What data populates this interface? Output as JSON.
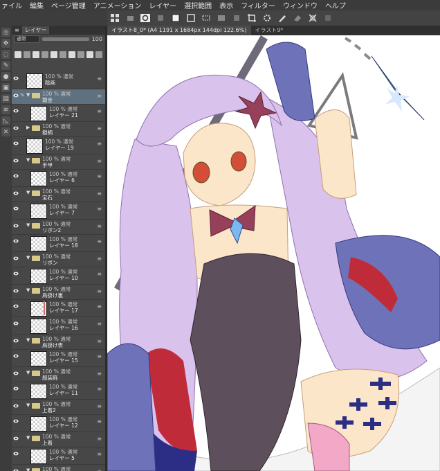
{
  "menu": [
    "ァイル",
    "編集",
    "ページ管理",
    "アニメーション",
    "レイヤー",
    "選択範囲",
    "表示",
    "フィルター",
    "ウィンドウ",
    "ヘルプ"
  ],
  "tabs": [
    {
      "label": "イラスト8_0* (A4 1191 x 1684px 144dpi 122.6%)",
      "active": true
    },
    {
      "label": "イラスト9*",
      "active": false
    }
  ],
  "panel": {
    "tab_label": "レイヤー",
    "blend_mode": "通常",
    "opacity": "100"
  },
  "layers": [
    {
      "mode": "100 % 通常",
      "name": "陰画",
      "kind": "layer",
      "level": 0
    },
    {
      "mode": "100 % 通常",
      "name": "鎖金",
      "kind": "folder",
      "level": 0,
      "selected": true
    },
    {
      "mode": "100 % 通常",
      "name": "レイヤー 21",
      "kind": "layer",
      "level": 1
    },
    {
      "mode": "100 % 通常",
      "name": "鎖柄",
      "kind": "folder",
      "level": 0,
      "collapsed": true
    },
    {
      "mode": "100 % 通常",
      "name": "レイヤー 19",
      "kind": "layer",
      "level": 0
    },
    {
      "mode": "100 % 通常",
      "name": "手甲",
      "kind": "folder",
      "level": 0
    },
    {
      "mode": "100 % 通常",
      "name": "レイヤー 6",
      "kind": "layer",
      "level": 1
    },
    {
      "mode": "100 % 通常",
      "name": "宝石",
      "kind": "folder",
      "level": 0
    },
    {
      "mode": "100 % 通常",
      "name": "レイヤー 7",
      "kind": "layer",
      "level": 1
    },
    {
      "mode": "100 % 通常",
      "name": "リボン2",
      "kind": "folder",
      "level": 0
    },
    {
      "mode": "100 % 通常",
      "name": "レイヤー 18",
      "kind": "layer",
      "level": 1
    },
    {
      "mode": "100 % 通常",
      "name": "リボン",
      "kind": "folder",
      "level": 0
    },
    {
      "mode": "100 % 通常",
      "name": "レイヤー 10",
      "kind": "layer",
      "level": 1
    },
    {
      "mode": "100 % 通常",
      "name": "肩掛け裏",
      "kind": "folder",
      "level": 0
    },
    {
      "mode": "100 % 通常",
      "name": "レイヤー 17",
      "kind": "layer",
      "level": 1,
      "mark": true
    },
    {
      "mode": "100 % 通常",
      "name": "レイヤー 16",
      "kind": "layer",
      "level": 1
    },
    {
      "mode": "100 % 通常",
      "name": "肩掛け表",
      "kind": "folder",
      "level": 0
    },
    {
      "mode": "100 % 通常",
      "name": "レイヤー 15",
      "kind": "layer",
      "level": 1
    },
    {
      "mode": "100 % 通常",
      "name": "服装飾",
      "kind": "folder",
      "level": 0
    },
    {
      "mode": "100 % 通常",
      "name": "レイヤー 11",
      "kind": "layer",
      "level": 1
    },
    {
      "mode": "100 % 通常",
      "name": "上着2",
      "kind": "folder",
      "level": 0
    },
    {
      "mode": "100 % 通常",
      "name": "レイヤー 12",
      "kind": "layer",
      "level": 1
    },
    {
      "mode": "100 % 通常",
      "name": "上着",
      "kind": "folder",
      "level": 0
    },
    {
      "mode": "100 % 通常",
      "name": "レイヤー 5",
      "kind": "layer",
      "level": 1
    },
    {
      "mode": "100 % 通常",
      "name": "",
      "kind": "folder",
      "level": 0
    }
  ],
  "colors": {
    "hair": "#d9c2ec",
    "skin": "#fbe6c9",
    "armor": "#6e72b8",
    "dress": "#5e4f5c",
    "bow": "#96405a",
    "red": "#c02b3a",
    "navy": "#2c2e86",
    "pink": "#f3a8c8",
    "selected_row": "#5f707e"
  }
}
